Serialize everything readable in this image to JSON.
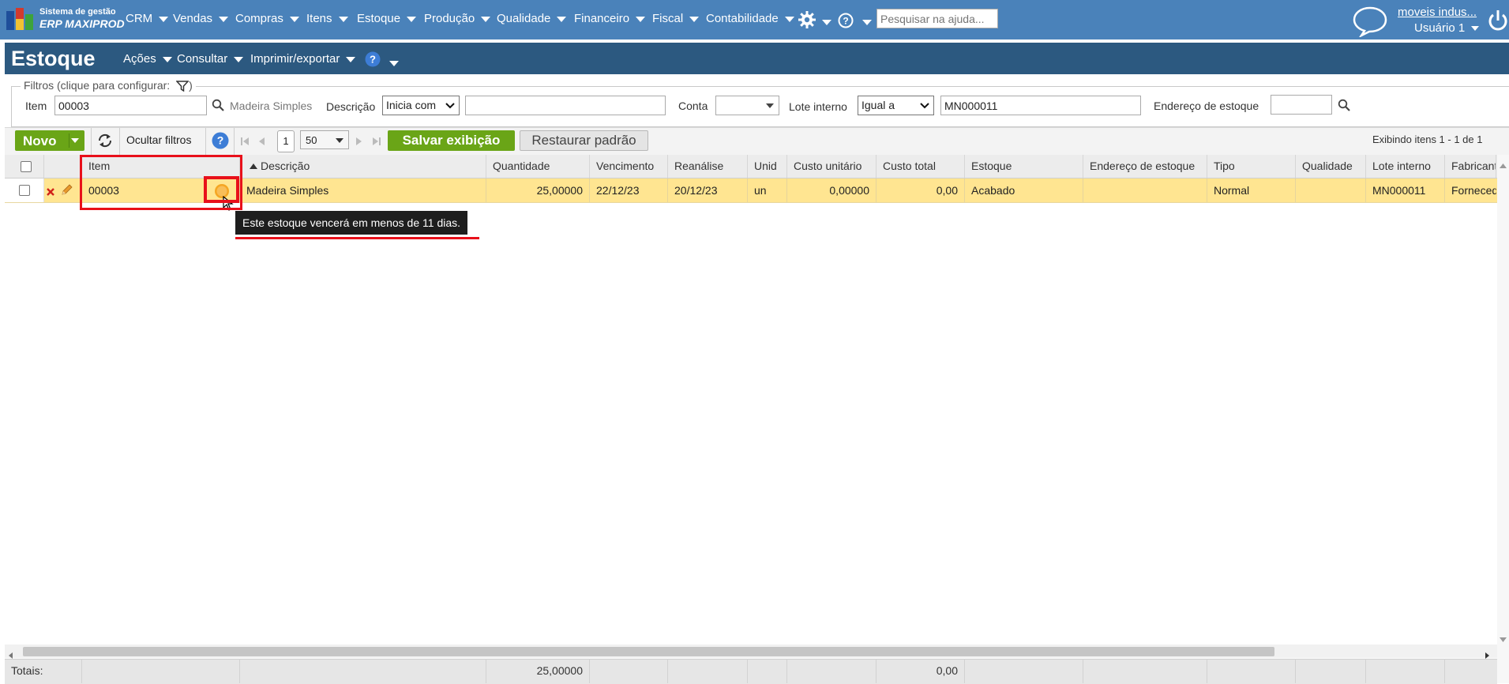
{
  "app": {
    "logo_line1": "Sistema de gestão",
    "logo_line2": "ERP MAXIPROD"
  },
  "top_menu": [
    "CRM",
    "Vendas",
    "Compras",
    "Itens",
    "Estoque",
    "Produção",
    "Qualidade",
    "Financeiro",
    "Fiscal",
    "Contabilidade"
  ],
  "help_search": {
    "placeholder": "Pesquisar na ajuda..."
  },
  "user": {
    "company": "moveis indus...",
    "name": "Usuário 1"
  },
  "page": {
    "title": "Estoque",
    "menus": [
      "Ações",
      "Consultar",
      "Imprimir/exportar"
    ]
  },
  "filters": {
    "legend": "Filtros (clique para configurar:",
    "legend_close": ")",
    "item_label": "Item",
    "item_value": "00003",
    "item_description": "Madeira Simples",
    "descricao_label": "Descrição",
    "descricao_operator": "Inicia com",
    "descricao_value": "",
    "conta_label": "Conta",
    "conta_value": "",
    "lote_label": "Lote interno",
    "lote_operator": "Igual a",
    "lote_value": "MN000011",
    "endereco_label": "Endereço de estoque",
    "endereco_value": ""
  },
  "toolbar": {
    "novo": "Novo",
    "ocultar_filtros": "Ocultar filtros",
    "page_number": "1",
    "page_size": "50",
    "salvar": "Salvar exibição",
    "restaurar": "Restaurar padrão",
    "range_info": "Exibindo itens 1 - 1 de 1"
  },
  "columns": [
    "Item",
    "Descrição",
    "Quantidade",
    "Vencimento",
    "Reanálise",
    "Unid",
    "Custo unitário",
    "Custo total",
    "Estoque",
    "Endereço de estoque",
    "Tipo",
    "Qualidade",
    "Lote interno",
    "Fabricante"
  ],
  "row": {
    "item": "00003",
    "descricao": "Madeira Simples",
    "quantidade": "25,00000",
    "vencimento": "22/12/23",
    "reanalise": "20/12/23",
    "unid": "un",
    "custo_unitario": "0,00000",
    "custo_total": "0,00",
    "estoque": "Acabado",
    "endereco": "",
    "tipo": "Normal",
    "qualidade": "",
    "lote": "MN000011",
    "fabricante": "Fornecedor"
  },
  "tooltip": "Este estoque vencerá em menos de 11 dias.",
  "totals": {
    "label": "Totais:",
    "quantidade": "25,00000",
    "custo_total": "0,00"
  },
  "colors": {
    "nav": "#4a82ba",
    "title_bar": "#2c5980",
    "row_highlight": "#ffe591",
    "green_button": "#6aa517",
    "annotation_red": "#e8101a",
    "status_dot": "#f0a020"
  }
}
